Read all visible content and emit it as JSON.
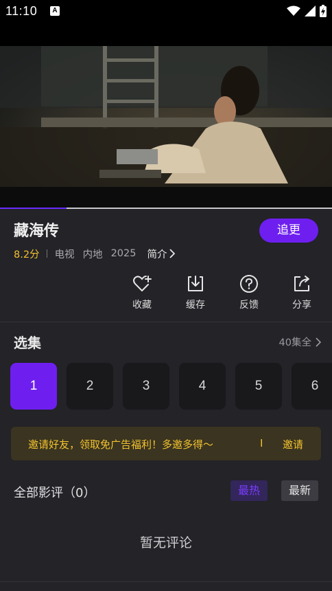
{
  "status_bar": {
    "time": "11:10",
    "notification_icon": "A"
  },
  "video": {
    "progress_percent": 20
  },
  "show": {
    "title": "藏海传",
    "follow_label": "追更",
    "score": "8.2分",
    "type": "电视",
    "region": "内地",
    "year": "2025",
    "intro_label": "简介"
  },
  "actions": [
    {
      "label": "收藏",
      "icon": "heart-plus-icon"
    },
    {
      "label": "缓存",
      "icon": "download-icon"
    },
    {
      "label": "反馈",
      "icon": "question-icon"
    },
    {
      "label": "分享",
      "icon": "share-icon"
    }
  ],
  "episodes": {
    "title": "选集",
    "count_label": "40集全",
    "items": [
      "1",
      "2",
      "3",
      "4",
      "5",
      "6"
    ],
    "selected": "1"
  },
  "invite": {
    "message": "邀请好友，领取免广告福利！多邀多得～",
    "separator": "I",
    "cta": "邀请"
  },
  "reviews": {
    "title": "全部影评（0）",
    "tab_hot": "最热",
    "tab_new": "最新",
    "empty_text": "暂无评论"
  },
  "colors": {
    "accent": "#6e1ff0",
    "score": "#f2c230",
    "background": "#232328"
  }
}
